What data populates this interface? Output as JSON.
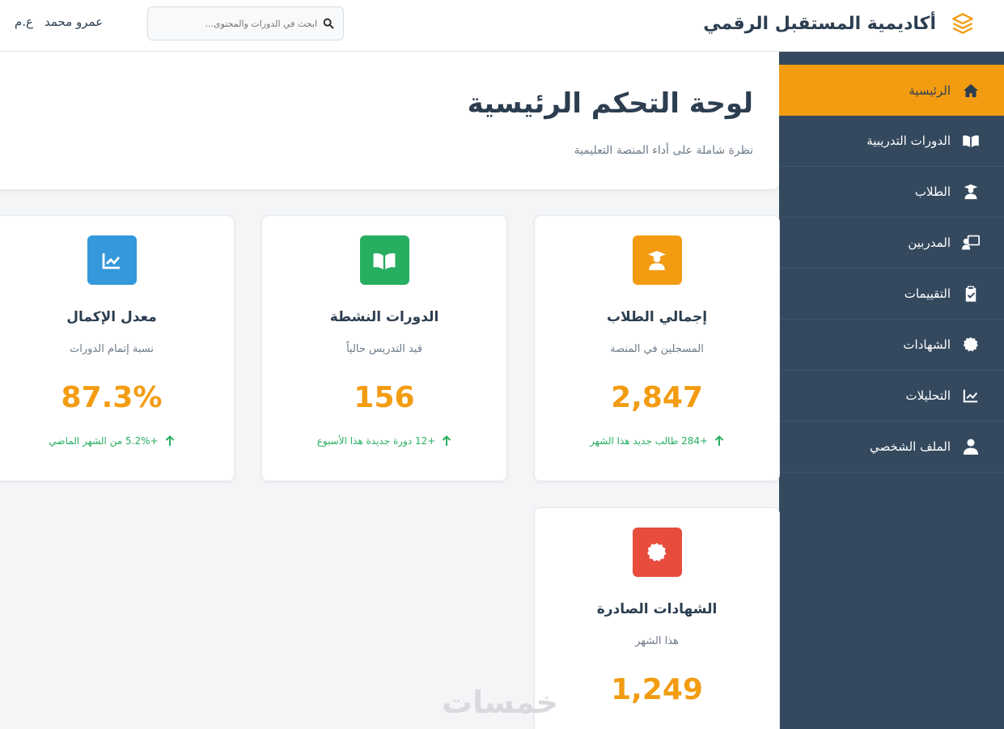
{
  "header": {
    "brand_title": "أكاديمية المستقبل الرقمي",
    "search_placeholder": "ابحث في الدورات والمحتوى...",
    "user_name": "عمرو محمد",
    "user_initials": "ع.م"
  },
  "sidebar": {
    "items": [
      {
        "label": "الرئيسية",
        "icon": "home-icon",
        "active": true
      },
      {
        "label": "الدورات التدريبية",
        "icon": "book-icon",
        "active": false
      },
      {
        "label": "الطلاب",
        "icon": "graduate-icon",
        "active": false
      },
      {
        "label": "المدربين",
        "icon": "teacher-icon",
        "active": false
      },
      {
        "label": "التقييمات",
        "icon": "clipboard-check-icon",
        "active": false
      },
      {
        "label": "الشهادات",
        "icon": "certificate-icon",
        "active": false
      },
      {
        "label": "التحليلات",
        "icon": "chart-line-icon",
        "active": false
      },
      {
        "label": "الملف الشخصي",
        "icon": "user-icon",
        "active": false
      }
    ]
  },
  "main": {
    "title": "لوحة التحكم الرئيسية",
    "subtitle": "نظرة شاملة على أداء المنصة التعليمية"
  },
  "stats": [
    {
      "title": "إجمالي الطلاب",
      "desc": "المسجلين في المنصة",
      "value": "2,847",
      "trend": "+284 طالب جديد هذا الشهر",
      "icon": "graduate-icon",
      "color": "#f39c12"
    },
    {
      "title": "الدورات النشطة",
      "desc": "قيد التدريس حالياً",
      "value": "156",
      "trend": "+12 دورة جديدة هذا الأسبوع",
      "icon": "book-icon",
      "color": "#27ae60"
    },
    {
      "title": "معدل الإكمال",
      "desc": "نسبة إتمام الدورات",
      "value": "87.3%",
      "trend": "+5.2% من الشهر الماضي",
      "icon": "chart-line-icon",
      "color": "#3498db"
    },
    {
      "title": "الشهادات الصادرة",
      "desc": "هذا الشهر",
      "value": "1,249",
      "trend": "",
      "icon": "certificate-icon",
      "color": "#e74c3c"
    }
  ],
  "colors": {
    "accent": "#f39c12",
    "sidebar_bg": "#34495e",
    "trend_up": "#27ae60"
  },
  "watermark": "خمسات"
}
